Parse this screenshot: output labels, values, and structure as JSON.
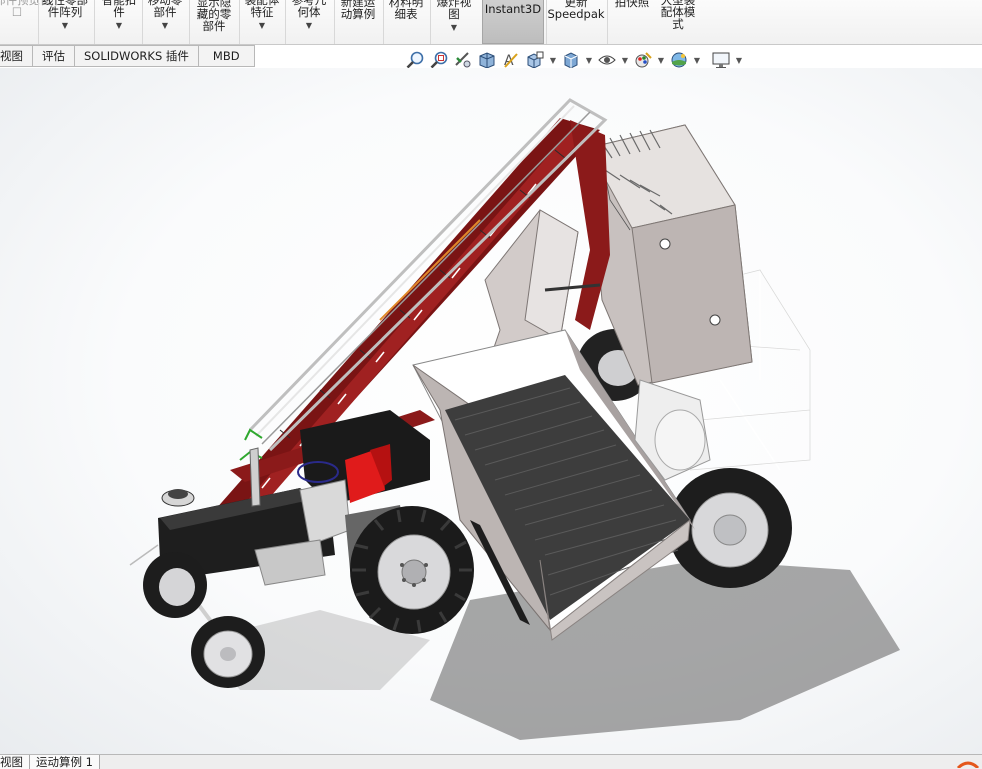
{
  "ribbon": {
    "items": [
      {
        "label": "零部件预览窗\n☐",
        "dim": true
      },
      {
        "label": "线性零部件阵列",
        "dropdown": true
      },
      {
        "label": "智能扣件",
        "dropdown": false
      },
      {
        "label": "移动零部件",
        "dropdown": true
      },
      {
        "label": "显示隐藏的零部件",
        "dropdown": false
      },
      {
        "label": "装配体特征",
        "dropdown": true
      },
      {
        "label": "参考几何体",
        "dropdown": true
      },
      {
        "label": "新建运动算例",
        "dropdown": false
      },
      {
        "label": "材料明细表",
        "dropdown": false
      },
      {
        "label": "爆炸视图",
        "dropdown": true
      },
      {
        "label": "Instant3D",
        "active": true
      },
      {
        "label": "更新\nSpeedpak",
        "dropdown": false
      },
      {
        "label": "拍快照",
        "dropdown": false
      },
      {
        "label": "大型装配体模式",
        "dropdown": false
      }
    ]
  },
  "tabs": [
    "视图",
    "评估",
    "SOLIDWORKS 插件",
    "MBD"
  ],
  "view_toolbar": {
    "icons": [
      "zoom-to-fit-icon",
      "zoom-to-area-icon",
      "previous-view-icon",
      "section-view-icon",
      "dynamic-annotation-icon",
      "view-orientation-icon",
      "display-style-icon",
      "hide-show-items-icon",
      "edit-appearance-icon",
      "apply-scene-icon",
      "view-settings-icon"
    ]
  },
  "model": {
    "name": "agricultural tractor with conveyor loader",
    "colors": {
      "frame_red": "#8b1a1a",
      "body_black": "#1f1f1f",
      "hopper_grey": "#c9c2c0",
      "bin_white": "#ffffff",
      "seat_red": "#e01b1b",
      "rail_grey": "#d9d9d9"
    }
  },
  "bottom_tabs": [
    "视图",
    "运动算例 1"
  ]
}
